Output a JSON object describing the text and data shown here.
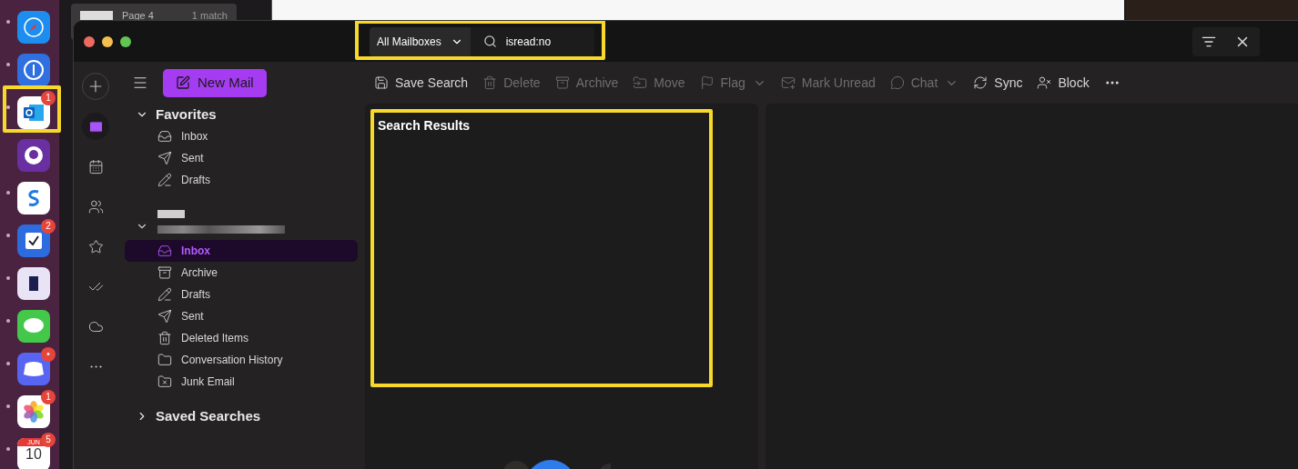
{
  "background_window": {
    "title": "Page 4",
    "matches": "1 match"
  },
  "dock": [
    {
      "running": true,
      "highlighted": false
    },
    {
      "running": true,
      "highlighted": false
    },
    {
      "running": true,
      "badge": "1",
      "highlighted": true
    },
    {
      "running": false,
      "highlighted": false
    },
    {
      "running": true,
      "highlighted": false
    },
    {
      "running": true,
      "badge": "2",
      "highlighted": false
    },
    {
      "running": true,
      "highlighted": false
    },
    {
      "running": true,
      "highlighted": false
    },
    {
      "running": true,
      "badge": "•",
      "highlighted": false
    },
    {
      "running": true,
      "badge": "1",
      "highlighted": false
    },
    {
      "running": true,
      "badge": "5",
      "highlighted": false,
      "month": "JUN",
      "day": "10"
    }
  ],
  "search_bar": {
    "scope": "All Mailboxes",
    "query": "isread:no",
    "highlighted": true
  },
  "rail": [
    {
      "selected": false
    },
    {
      "selected": true
    },
    {
      "selected": false
    },
    {
      "selected": false
    },
    {
      "selected": false
    },
    {
      "selected": false
    },
    {
      "selected": false
    },
    {
      "selected": false
    }
  ],
  "new_mail_button": "New Mail",
  "folder_groups": [
    {
      "kind": "section",
      "title": "Favorites",
      "expanded": true,
      "items": [
        {
          "label": "Inbox",
          "selected": false
        },
        {
          "label": "Sent",
          "selected": false
        },
        {
          "label": "Drafts",
          "selected": false
        }
      ]
    },
    {
      "kind": "account",
      "expanded": true,
      "items": [
        {
          "label": "Inbox",
          "selected": true
        },
        {
          "label": "Archive",
          "selected": false
        },
        {
          "label": "Drafts",
          "selected": false
        },
        {
          "label": "Sent",
          "selected": false
        },
        {
          "label": "Deleted Items",
          "selected": false
        },
        {
          "label": "Conversation History",
          "selected": false
        },
        {
          "label": "Junk Email",
          "selected": false
        }
      ]
    },
    {
      "kind": "section",
      "title": "Saved Searches",
      "expanded": false
    }
  ],
  "toolbar": [
    {
      "label": "Save Search",
      "disabled": false,
      "has_menu": false
    },
    {
      "label": "Delete",
      "disabled": true,
      "has_menu": false
    },
    {
      "label": "Archive",
      "disabled": true,
      "has_menu": false
    },
    {
      "label": "Move",
      "disabled": true,
      "has_menu": false
    },
    {
      "label": "Flag",
      "disabled": true,
      "has_menu": true
    },
    {
      "label": "Mark Unread",
      "disabled": true,
      "has_menu": false
    },
    {
      "label": "Chat",
      "disabled": true,
      "has_menu": true
    },
    {
      "label": "Sync",
      "disabled": false,
      "has_menu": false
    },
    {
      "label": "Block",
      "disabled": false,
      "has_menu": false
    }
  ],
  "message_list": {
    "title": "Search Results",
    "highlighted": true
  }
}
